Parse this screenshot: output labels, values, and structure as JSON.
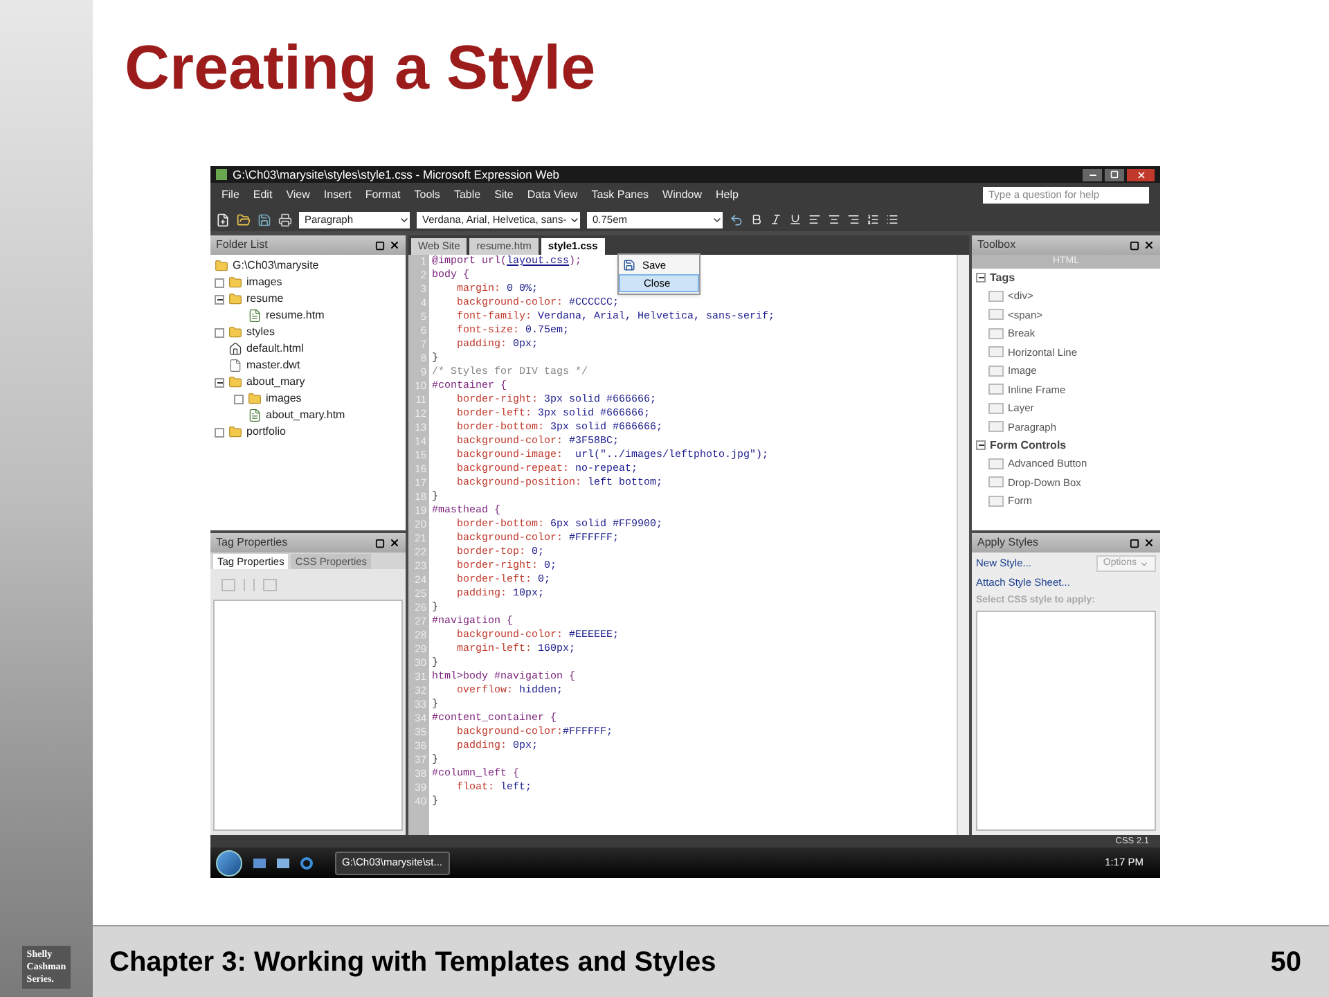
{
  "slide": {
    "title": "Creating a Style",
    "footer": "Chapter 3: Working with Templates and Styles",
    "page": "50",
    "logo": [
      "Shelly",
      "Cashman",
      "Series."
    ]
  },
  "window": {
    "title": "G:\\Ch03\\marysite\\styles\\style1.css - Microsoft Expression Web"
  },
  "menu": [
    "File",
    "Edit",
    "View",
    "Insert",
    "Format",
    "Tools",
    "Table",
    "Site",
    "Data View",
    "Task Panes",
    "Window",
    "Help"
  ],
  "help_search": {
    "placeholder": "Type a question for help"
  },
  "toolbar": {
    "style": "Paragraph",
    "font": "Verdana, Arial, Helvetica, sans-",
    "size": "0.75em"
  },
  "folder_list": {
    "title": "Folder List",
    "root": {
      "name": "G:\\Ch03\\marysite",
      "children": [
        {
          "name": "images",
          "kind": "folder",
          "expanded": false
        },
        {
          "name": "resume",
          "kind": "folder",
          "expanded": true,
          "children": [
            {
              "name": "resume.htm",
              "kind": "page"
            }
          ]
        },
        {
          "name": "styles",
          "kind": "folder",
          "expanded": false
        },
        {
          "name": "default.html",
          "kind": "home"
        },
        {
          "name": "master.dwt",
          "kind": "template"
        },
        {
          "name": "about_mary",
          "kind": "folder",
          "expanded": true,
          "children": [
            {
              "name": "images",
              "kind": "folder",
              "expanded": false
            },
            {
              "name": "about_mary.htm",
              "kind": "page"
            }
          ]
        },
        {
          "name": "portfolio",
          "kind": "folder",
          "expanded": false
        }
      ]
    }
  },
  "tag_properties": {
    "title": "Tag Properties",
    "tabs": [
      {
        "label": "Tag Properties",
        "selected": true
      },
      {
        "label": "CSS Properties",
        "selected": false
      }
    ]
  },
  "doc_tabs": [
    {
      "label": "Web Site",
      "selected": false
    },
    {
      "label": "resume.htm",
      "selected": false
    },
    {
      "label": "style1.css",
      "selected": true
    }
  ],
  "context_menu": [
    {
      "label": "Save",
      "highlighted": false
    },
    {
      "label": "Close",
      "highlighted": true
    }
  ],
  "code": [
    {
      "number": "1",
      "kind": "import",
      "before": "@import url(",
      "link": "layout.css",
      "after": ");"
    },
    {
      "number": "2",
      "kind": "selector",
      "text": "body {"
    },
    {
      "number": "3",
      "kind": "decl",
      "property": "    margin:",
      "value": " 0 0%;"
    },
    {
      "number": "4",
      "kind": "decl",
      "property": "    background-color:",
      "value": " #CCCCCC;"
    },
    {
      "number": "5",
      "kind": "decl",
      "property": "    font-family:",
      "value": " Verdana, Arial, Helvetica, sans-serif;"
    },
    {
      "number": "6",
      "kind": "decl",
      "property": "    font-size:",
      "value": " 0.75em;"
    },
    {
      "number": "7",
      "kind": "decl",
      "property": "    padding:",
      "value": " 0px;"
    },
    {
      "number": "8",
      "kind": "brace",
      "text": "}"
    },
    {
      "number": "9",
      "kind": "comment",
      "text": "/* Styles for DIV tags */"
    },
    {
      "number": "10",
      "kind": "selector",
      "text": "#container {"
    },
    {
      "number": "11",
      "kind": "decl",
      "property": "    border-right:",
      "value": " 3px solid #666666;"
    },
    {
      "number": "12",
      "kind": "decl",
      "property": "    border-left:",
      "value": " 3px solid #666666;"
    },
    {
      "number": "13",
      "kind": "decl",
      "property": "    border-bottom:",
      "value": " 3px solid #666666;"
    },
    {
      "number": "14",
      "kind": "decl",
      "property": "    background-color:",
      "value": " #3F58BC;"
    },
    {
      "number": "15",
      "kind": "decl",
      "property": "    background-image:",
      "value": "  url(\"../images/leftphoto.jpg\");"
    },
    {
      "number": "16",
      "kind": "decl",
      "property": "    background-repeat:",
      "value": " no-repeat;"
    },
    {
      "number": "17",
      "kind": "decl",
      "property": "    background-position:",
      "value": " left bottom;"
    },
    {
      "number": "18",
      "kind": "brace",
      "text": "}"
    },
    {
      "number": "19",
      "kind": "selector",
      "text": "#masthead {"
    },
    {
      "number": "20",
      "kind": "decl",
      "property": "    border-bottom:",
      "value": " 6px solid #FF9900;"
    },
    {
      "number": "21",
      "kind": "decl",
      "property": "    background-color:",
      "value": " #FFFFFF;"
    },
    {
      "number": "22",
      "kind": "decl",
      "property": "    border-top:",
      "value": " 0;"
    },
    {
      "number": "23",
      "kind": "decl",
      "property": "    border-right:",
      "value": " 0;"
    },
    {
      "number": "24",
      "kind": "decl",
      "property": "    border-left:",
      "value": " 0;"
    },
    {
      "number": "25",
      "kind": "decl",
      "property": "    padding:",
      "value": " 10px;"
    },
    {
      "number": "26",
      "kind": "brace",
      "text": "}"
    },
    {
      "number": "27",
      "kind": "selector",
      "text": "#navigation {"
    },
    {
      "number": "28",
      "kind": "decl",
      "property": "    background-color:",
      "value": " #EEEEEE;"
    },
    {
      "number": "29",
      "kind": "decl",
      "property": "    margin-left:",
      "value": " 160px;"
    },
    {
      "number": "30",
      "kind": "brace",
      "text": "}"
    },
    {
      "number": "31",
      "kind": "selector",
      "text": "html>body #navigation {"
    },
    {
      "number": "32",
      "kind": "decl",
      "property": "    overflow:",
      "value": " hidden;"
    },
    {
      "number": "33",
      "kind": "brace",
      "text": "}"
    },
    {
      "number": "34",
      "kind": "selector",
      "text": "#content_container {"
    },
    {
      "number": "35",
      "kind": "decl",
      "property": "    background-color:",
      "value": "#FFFFFF;"
    },
    {
      "number": "36",
      "kind": "decl",
      "property": "    padding:",
      "value": " 0px;"
    },
    {
      "number": "37",
      "kind": "brace",
      "text": "}"
    },
    {
      "number": "38",
      "kind": "selector",
      "text": "#column_left {"
    },
    {
      "number": "39",
      "kind": "decl",
      "property": "    float:",
      "value": " left;"
    },
    {
      "number": "40",
      "kind": "brace",
      "text": "}"
    }
  ],
  "toolbox": {
    "title": "Toolbox",
    "section": "HTML",
    "groups": [
      {
        "label": "Tags",
        "expanded": true,
        "items": [
          "<div>",
          "<span>",
          "Break",
          "Horizontal Line",
          "Image",
          "Inline Frame",
          "Layer",
          "Paragraph"
        ]
      },
      {
        "label": "Form Controls",
        "expanded": true,
        "items": [
          "Advanced Button",
          "Drop-Down Box",
          "Form"
        ]
      }
    ]
  },
  "apply_styles": {
    "title": "Apply Styles",
    "new_style": "New Style...",
    "options": "Options",
    "attach": "Attach Style Sheet...",
    "prompt": "Select CSS style to apply:"
  },
  "status_bar": {
    "schema": "CSS 2.1"
  },
  "taskbar": {
    "task": "G:\\Ch03\\marysite\\st...",
    "time": "1:17 PM"
  }
}
